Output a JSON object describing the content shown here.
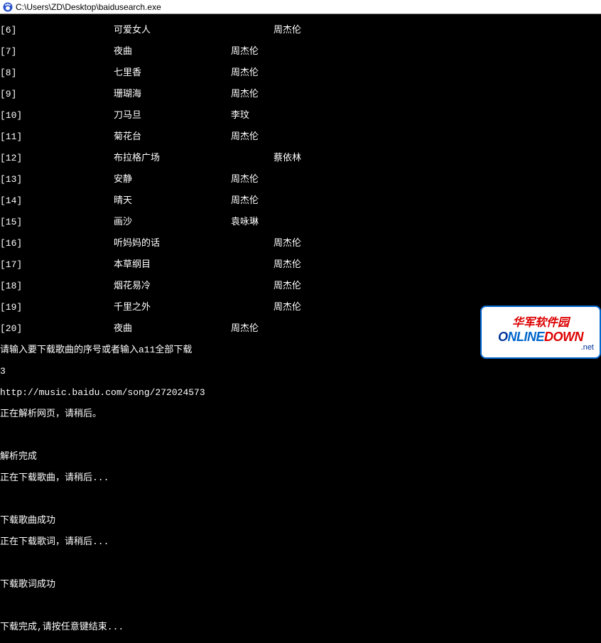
{
  "window": {
    "title_path": "C:\\Users\\ZD\\Desktop\\baidusearch.exe"
  },
  "songs": [
    {
      "idx": "[6]",
      "name": "可爱女人",
      "artist_col": "",
      "artist_col2": "周杰伦"
    },
    {
      "idx": "[7]",
      "name": "夜曲",
      "artist_col": "周杰伦",
      "artist_col2": ""
    },
    {
      "idx": "[8]",
      "name": "七里香",
      "artist_col": "周杰伦",
      "artist_col2": ""
    },
    {
      "idx": "[9]",
      "name": "珊瑚海",
      "artist_col": "周杰伦",
      "artist_col2": ""
    },
    {
      "idx": "[10]",
      "name": "刀马旦",
      "artist_col": "李玟",
      "artist_col2": ""
    },
    {
      "idx": "[11]",
      "name": "菊花台",
      "artist_col": "周杰伦",
      "artist_col2": ""
    },
    {
      "idx": "[12]",
      "name": "布拉格广场",
      "artist_col": "",
      "artist_col2": "蔡依林"
    },
    {
      "idx": "[13]",
      "name": "安静",
      "artist_col": "周杰伦",
      "artist_col2": ""
    },
    {
      "idx": "[14]",
      "name": "晴天",
      "artist_col": "周杰伦",
      "artist_col2": ""
    },
    {
      "idx": "[15]",
      "name": "画沙",
      "artist_col": "袁咏琳",
      "artist_col2": ""
    },
    {
      "idx": "[16]",
      "name": "听妈妈的话",
      "artist_col": "",
      "artist_col2": "周杰伦"
    },
    {
      "idx": "[17]",
      "name": "本草纲目",
      "artist_col": "",
      "artist_col2": "周杰伦"
    },
    {
      "idx": "[18]",
      "name": "烟花易冷",
      "artist_col": "",
      "artist_col2": "周杰伦"
    },
    {
      "idx": "[19]",
      "name": "千里之外",
      "artist_col": "",
      "artist_col2": "周杰伦"
    },
    {
      "idx": "[20]",
      "name": "夜曲",
      "artist_col": "周杰伦",
      "artist_col2": ""
    }
  ],
  "prompt_line": "请输入要下载歌曲的序号或者输入a11全部下载",
  "input_value": "3",
  "url_line": "http://music.baidu.com/song/272024573",
  "status": {
    "parsing": "正在解析网页，请稍后。",
    "parse_done": "解析完成",
    "downloading_song": "正在下载歌曲，请稍后...",
    "song_done": "下载歌曲成功",
    "downloading_lyric": "正在下载歌词，请稍后...",
    "lyric_done": "下载歌词成功",
    "finish": "下载完成,请按任意键结束..."
  },
  "watermark": {
    "cn": "华军软件园",
    "en_o": "O",
    "en_nline": "NLINE",
    "en_down": "DOWN",
    "net": ".net"
  }
}
